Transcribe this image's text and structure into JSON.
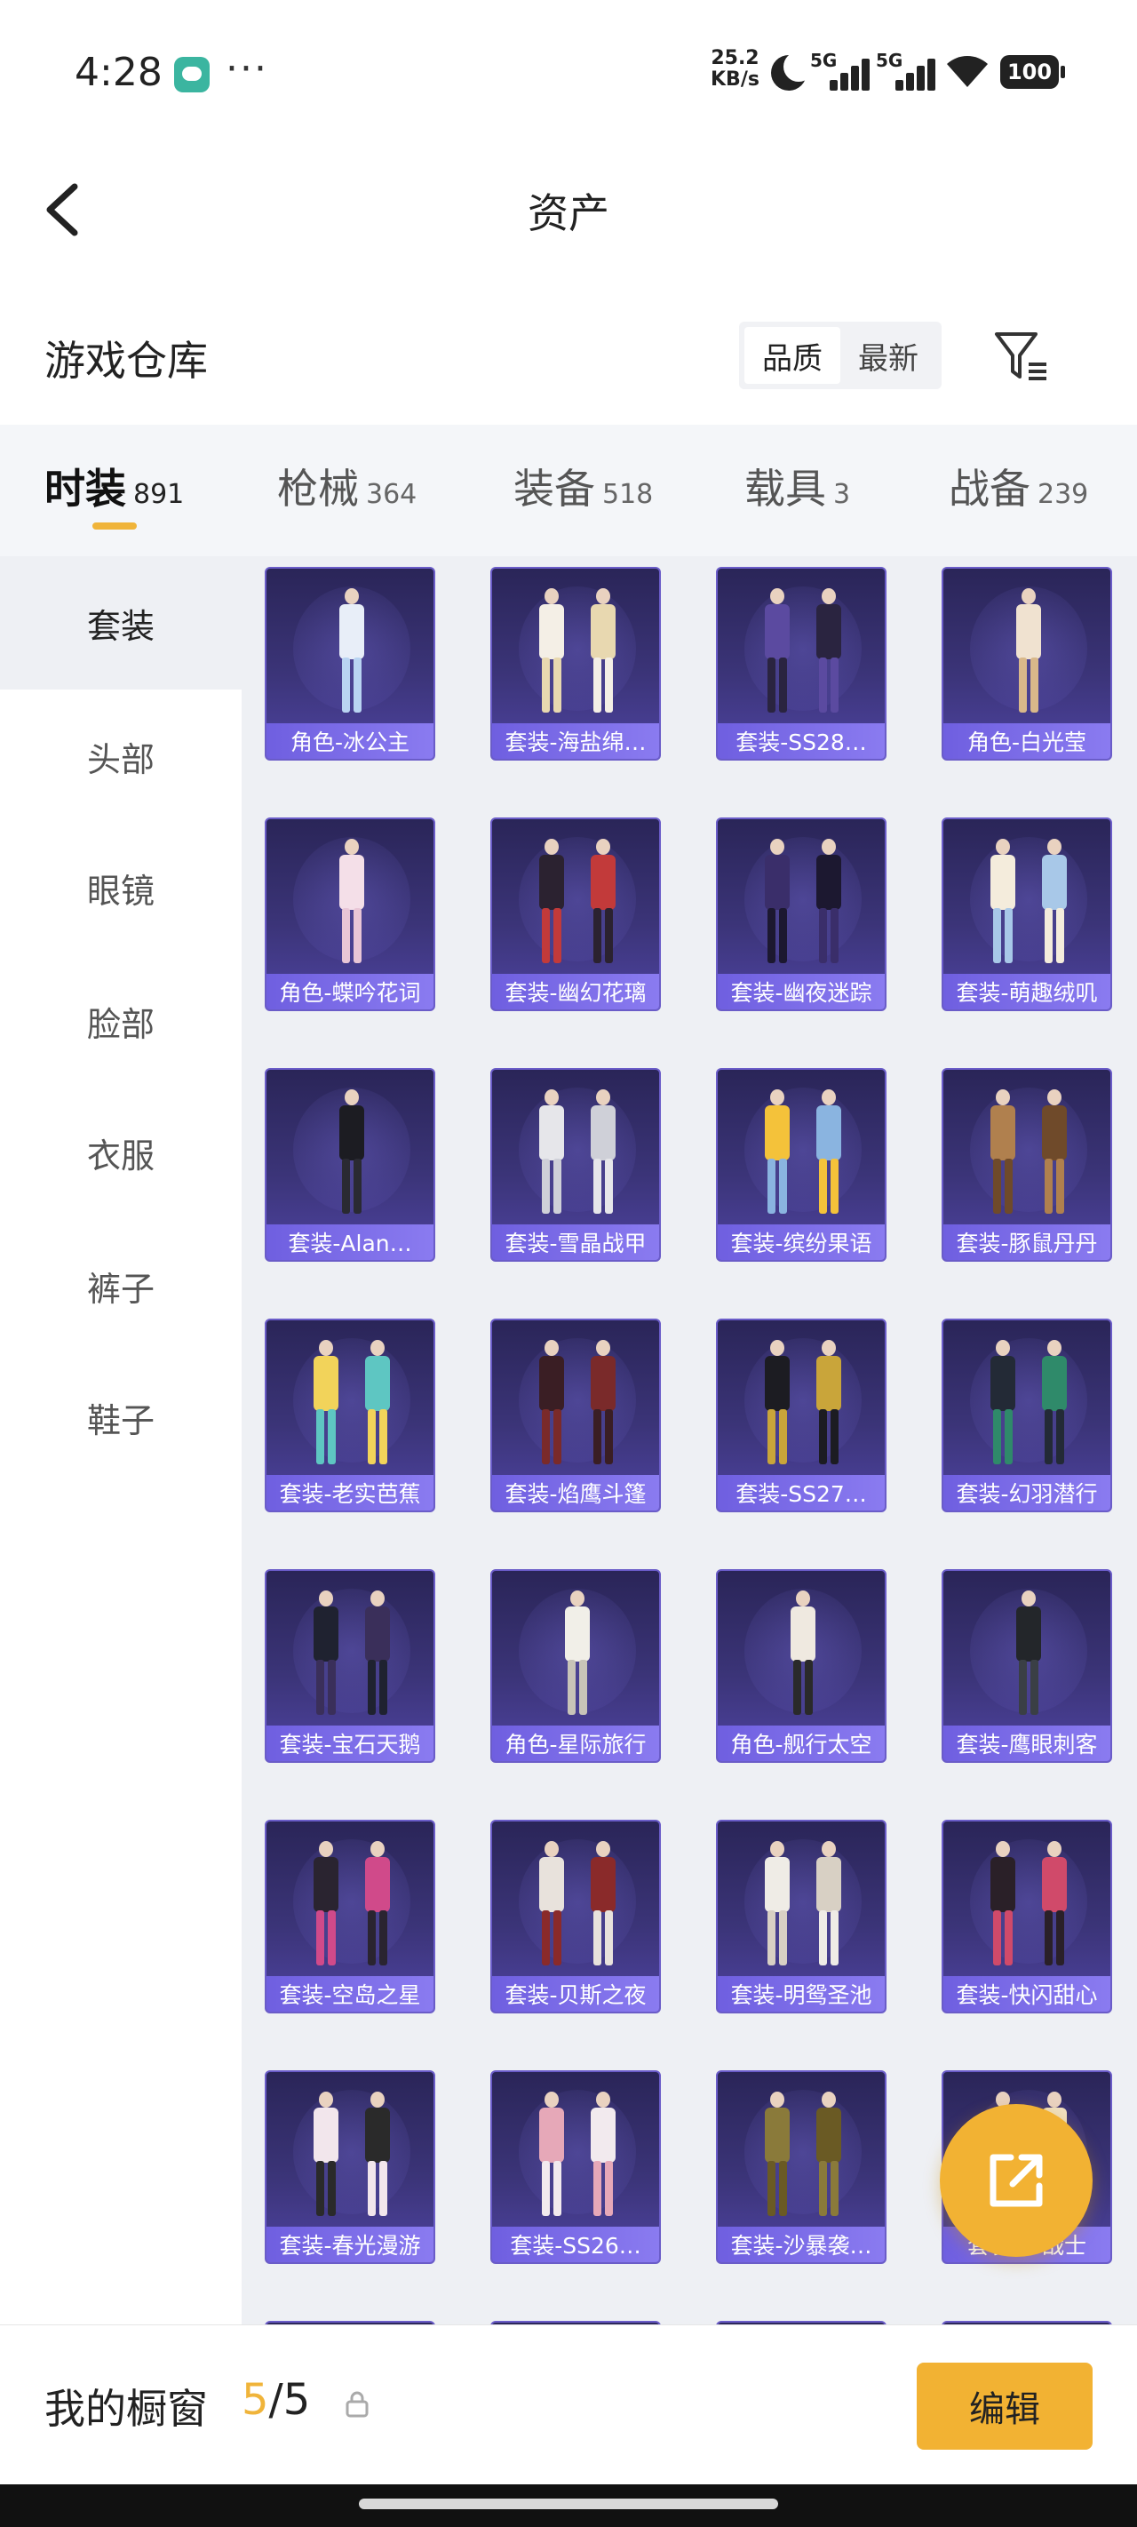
{
  "status_bar": {
    "time": "4:28",
    "more_dots": "···",
    "net_speed_value": "25.2",
    "net_speed_unit": "KB/s",
    "signal_labels": [
      "5G",
      "5G"
    ],
    "battery": "100",
    "icons": [
      "wechat-icon",
      "moon-icon",
      "signal-icon",
      "wifi-icon",
      "battery-icon"
    ]
  },
  "header": {
    "title": "资产",
    "back_icon": "chevron-left-icon"
  },
  "warehouse": {
    "title": "游戏仓库",
    "sort_options": [
      "品质",
      "最新"
    ],
    "sort_active": "品质",
    "filter_icon": "filter-icon"
  },
  "tabs": [
    {
      "label": "时装",
      "count": "891",
      "active": true
    },
    {
      "label": "枪械",
      "count": "364",
      "active": false
    },
    {
      "label": "装备",
      "count": "518",
      "active": false
    },
    {
      "label": "载具",
      "count": "3",
      "active": false
    },
    {
      "label": "战备",
      "count": "239",
      "active": false
    }
  ],
  "sidebar": {
    "items": [
      {
        "label": "套装",
        "active": true
      },
      {
        "label": "头部",
        "active": false
      },
      {
        "label": "眼镜",
        "active": false
      },
      {
        "label": "脸部",
        "active": false
      },
      {
        "label": "衣服",
        "active": false
      },
      {
        "label": "裤子",
        "active": false
      },
      {
        "label": "鞋子",
        "active": false
      }
    ]
  },
  "items": [
    {
      "label": "角色-冰公主"
    },
    {
      "label": "套装-海盐绵…"
    },
    {
      "label": "套装-SS28…"
    },
    {
      "label": "角色-白光莹"
    },
    {
      "label": "角色-蝶吟花词"
    },
    {
      "label": "套装-幽幻花璃"
    },
    {
      "label": "套装-幽夜迷踪"
    },
    {
      "label": "套装-萌趣绒叽"
    },
    {
      "label": "套装-Alan…"
    },
    {
      "label": "套装-雪晶战甲"
    },
    {
      "label": "套装-缤纷果语"
    },
    {
      "label": "套装-豚鼠丹丹"
    },
    {
      "label": "套装-老实芭蕉"
    },
    {
      "label": "套装-焰鹰斗篷"
    },
    {
      "label": "套装-SS27…"
    },
    {
      "label": "套装-幻羽潜行"
    },
    {
      "label": "套装-宝石天鹅"
    },
    {
      "label": "角色-星际旅行"
    },
    {
      "label": "角色-舰行太空"
    },
    {
      "label": "套装-鹰眼刺客"
    },
    {
      "label": "套装-空岛之星"
    },
    {
      "label": "套装-贝斯之夜"
    },
    {
      "label": "套装-明鸳圣池"
    },
    {
      "label": "套装-快闪甜心"
    },
    {
      "label": "套装-春光漫游"
    },
    {
      "label": "套装-SS26…"
    },
    {
      "label": "套装-沙暴袭…"
    },
    {
      "label": "套装-…战士"
    }
  ],
  "fab": {
    "icon": "share-icon"
  },
  "bottom_bar": {
    "showcase_label": "我的橱窗",
    "showcase_current": "5",
    "showcase_sep": "/",
    "showcase_total": "5",
    "lock_icon": "lock-icon",
    "edit_label": "编辑"
  }
}
